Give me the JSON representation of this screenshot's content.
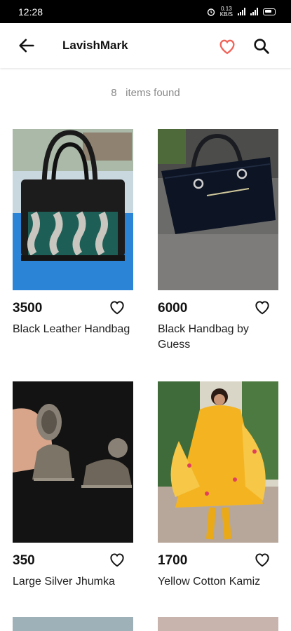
{
  "status_bar": {
    "time": "12:28",
    "speed_value": "0.13",
    "speed_unit": "KB/S",
    "battery": "55"
  },
  "app_bar": {
    "title": "LavishMark"
  },
  "results": {
    "count": "8",
    "label": "items found"
  },
  "products": [
    {
      "price": "3500",
      "name": "Black Leather Handbag"
    },
    {
      "price": "6000",
      "name": "Black Handbag by Guess"
    },
    {
      "price": "350",
      "name": "Large Silver Jhumka"
    },
    {
      "price": "1700",
      "name": "Yellow Cotton Kamiz"
    }
  ],
  "colors": {
    "accent": "#f0645a",
    "status_bar": "#000000"
  }
}
